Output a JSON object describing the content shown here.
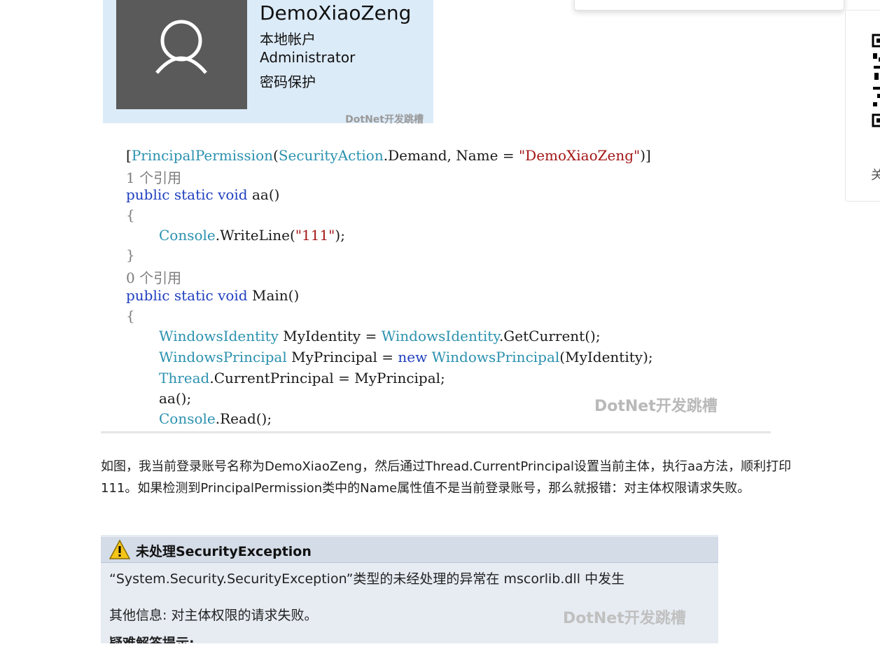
{
  "account_card": {
    "name": "DemoXiaoZeng",
    "type": "本地帐户",
    "role": "Administrator",
    "security": "密码保护",
    "watermark": "DotNet开发跳槽"
  },
  "code": {
    "line1_a": "[",
    "line1_attr": "PrincipalPermission",
    "line1_b": "(",
    "line1_enum": "SecurityAction",
    "line1_c": ".Demand, Name = ",
    "line1_str": "\"DemoXiaoZeng\"",
    "line1_d": ")]",
    "ref1": "1 个引用",
    "kw_public": "public",
    "kw_static": "static",
    "kw_void": "void",
    "m1_name": "aa()",
    "brace_open": "{",
    "brace_close": "}",
    "console": "Console",
    "writeline": ".WriteLine(",
    "str111": "\"111\"",
    "end_paren": ");",
    "ref0": "0 个引用",
    "m2_name": "Main()",
    "wi_type": "WindowsIdentity",
    "wi_mid": " MyIdentity = ",
    "wi_call": ".GetCurrent();",
    "wp_type": "WindowsPrincipal",
    "wp_mid": " MyPrincipal = ",
    "kw_new": "new",
    "wp_end": "(MyIdentity);",
    "thread": "Thread",
    "thread_rest": ".CurrentPrincipal = MyPrincipal;",
    "call_aa": "aa();",
    "read": ".Read();",
    "watermark": "DotNet开发跳槽"
  },
  "paragraph": "如图，我当前登录账号名称为DemoXiaoZeng，然后通过Thread.CurrentPrincipal设置当前主体，执行aa方法，顺利打印111。如果检测到PrincipalPermission类中的Name属性值不是当前登录账号，那么就报错：对主体权限请求失败。",
  "exception": {
    "title": "未处理SecurityException",
    "message": "“System.Security.SecurityException”类型的未经处理的异常在 mscorlib.dll 中发生",
    "info": "其他信息: 对主体权限的请求失败。",
    "cut_text": "疑难解答提示:",
    "watermark": "DotNet开发跳槽"
  },
  "sidebar": {
    "text": "关"
  }
}
